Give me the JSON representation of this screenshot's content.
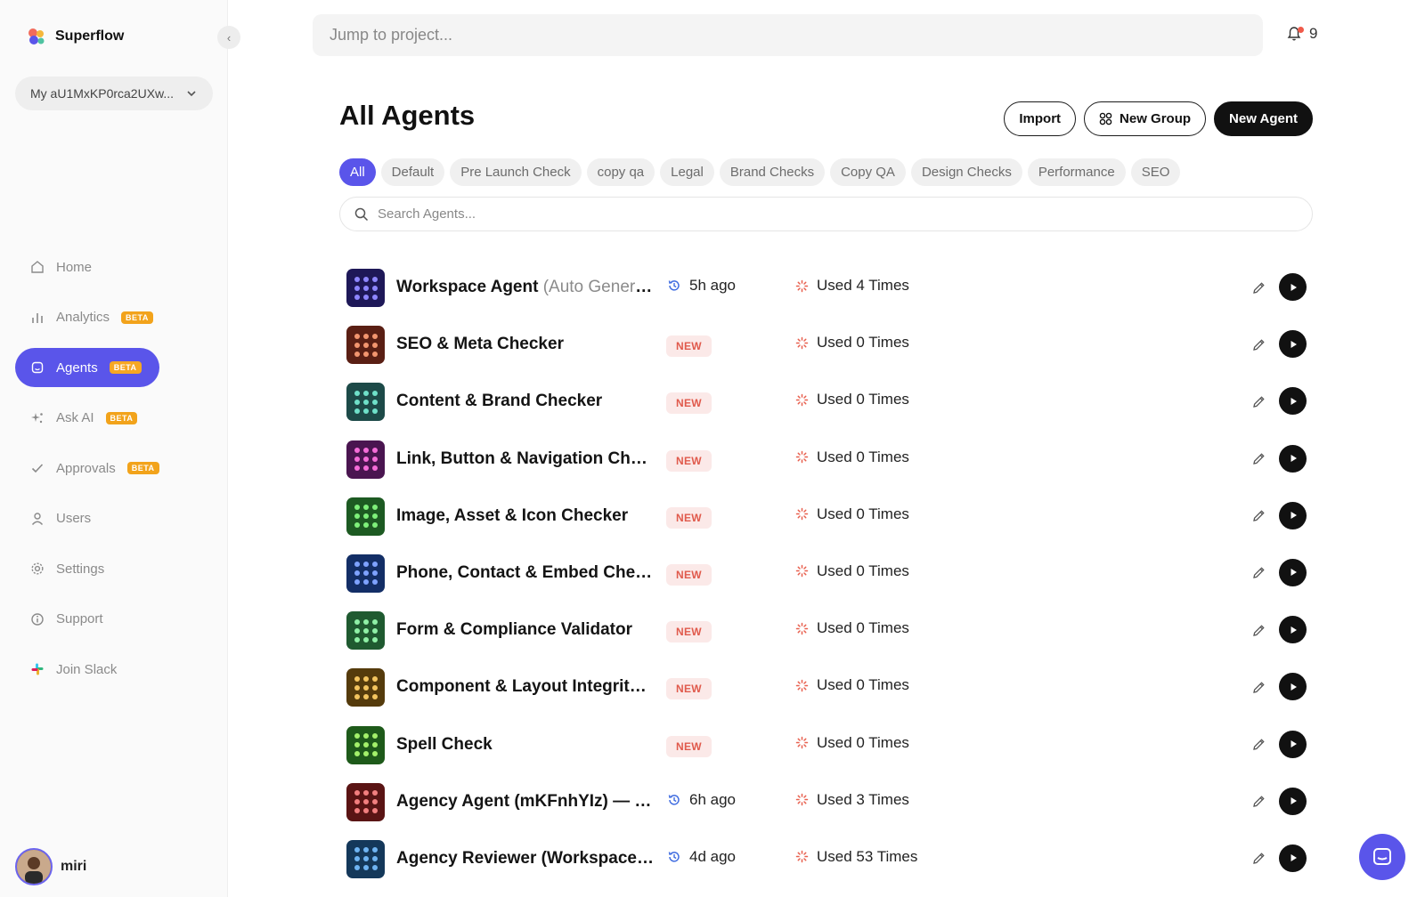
{
  "brand": {
    "name": "Superflow"
  },
  "workspace": {
    "name": "My aU1MxKP0rca2UXw..."
  },
  "nav": [
    {
      "label": "Home",
      "icon": "home-icon",
      "beta": ""
    },
    {
      "label": "Analytics",
      "icon": "bar-chart-icon",
      "beta": "BETA"
    },
    {
      "label": "Agents",
      "icon": "agent-icon",
      "beta": "BETA",
      "active": true
    },
    {
      "label": "Ask AI",
      "icon": "sparkle-icon",
      "beta": "BETA"
    },
    {
      "label": "Approvals",
      "icon": "check-icon",
      "beta": "BETA"
    },
    {
      "label": "Users",
      "icon": "user-icon",
      "beta": ""
    },
    {
      "label": "Settings",
      "icon": "gear-icon",
      "beta": ""
    },
    {
      "label": "Support",
      "icon": "info-icon",
      "beta": ""
    },
    {
      "label": "Join Slack",
      "icon": "slack-icon",
      "beta": ""
    }
  ],
  "user": {
    "name": "miri"
  },
  "topbar": {
    "jump_placeholder": "Jump to project...",
    "notification_count": "9"
  },
  "page": {
    "title": "All Agents",
    "import_label": "Import",
    "new_group_label": "New Group",
    "new_agent_label": "New Agent",
    "search_placeholder": "Search Agents..."
  },
  "filters": [
    "All",
    "Default",
    "Pre Launch Check",
    "copy qa",
    "Legal",
    "Brand Checks",
    "Copy QA",
    "Design Checks",
    "Performance",
    "SEO"
  ],
  "colors": {
    "accent": "#5a55ea",
    "beta": "#f2a31b",
    "new_text": "#e05a4c",
    "new_bg": "#fbe9e8"
  },
  "agents": [
    {
      "name": "Workspace Agent",
      "sub": " (Auto Genera...",
      "when": "5h ago",
      "badge": "",
      "used": "Used 4 Times",
      "bg": "#1e1858",
      "dot": "#8e86ff"
    },
    {
      "name": "SEO & Meta Checker",
      "sub": "",
      "when": "",
      "badge": "NEW",
      "used": "Used 0 Times",
      "bg": "#5a1f14",
      "dot": "#f2956f"
    },
    {
      "name": "Content & Brand Checker",
      "sub": "",
      "when": "",
      "badge": "NEW",
      "used": "Used 0 Times",
      "bg": "#1d4a48",
      "dot": "#6fe0c9"
    },
    {
      "name": "Link, Button & Navigation Check...",
      "sub": "",
      "when": "",
      "badge": "NEW",
      "used": "Used 0 Times",
      "bg": "#4a1550",
      "dot": "#f56cd8"
    },
    {
      "name": "Image, Asset & Icon Checker",
      "sub": "",
      "when": "",
      "badge": "NEW",
      "used": "Used 0 Times",
      "bg": "#1d5a22",
      "dot": "#7ef07a"
    },
    {
      "name": "Phone, Contact & Embed Check...",
      "sub": "",
      "when": "",
      "badge": "NEW",
      "used": "Used 0 Times",
      "bg": "#132e66",
      "dot": "#7ea2ff"
    },
    {
      "name": "Form & Compliance Validator",
      "sub": "",
      "when": "",
      "badge": "NEW",
      "used": "Used 0 Times",
      "bg": "#1f5a30",
      "dot": "#8ff0a6"
    },
    {
      "name": "Component & Layout Integrity ...",
      "sub": "",
      "when": "",
      "badge": "NEW",
      "used": "Used 0 Times",
      "bg": "#553b0c",
      "dot": "#f3c45f"
    },
    {
      "name": "Spell Check",
      "sub": "",
      "when": "",
      "badge": "NEW",
      "used": "Used 0 Times",
      "bg": "#1e5a1a",
      "dot": "#a3f06a"
    },
    {
      "name": "Agency Agent (mKFnhYIz) — W...",
      "sub": "",
      "when": "6h ago",
      "badge": "",
      "used": "Used 3 Times",
      "bg": "#5a1414",
      "dot": "#f27f7f"
    },
    {
      "name": "Agency Reviewer (Workspace ...",
      "sub": "",
      "when": "4d ago",
      "badge": "",
      "used": "Used 53 Times",
      "bg": "#14385a",
      "dot": "#6fb4f2"
    }
  ]
}
